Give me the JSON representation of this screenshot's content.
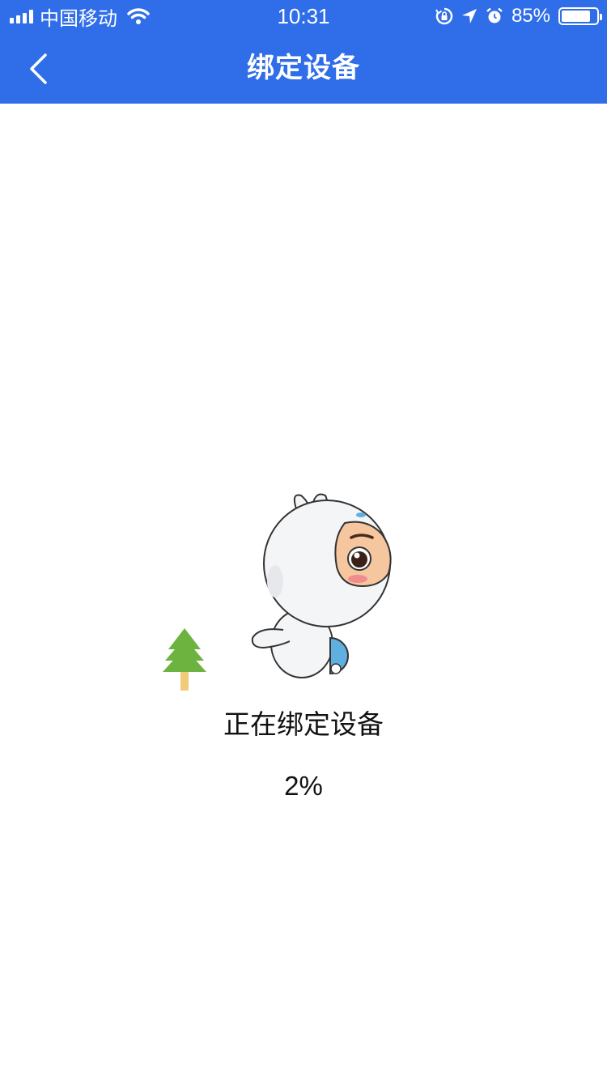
{
  "status_bar": {
    "carrier": "中国移动",
    "time": "10:31",
    "battery_percent_text": "85%",
    "battery_level": 0.85
  },
  "nav": {
    "title": "绑定设备",
    "back_icon": "chevron-left-icon"
  },
  "binding": {
    "status_label": "正在绑定设备",
    "progress_text": "2%",
    "progress": 0.02
  },
  "colors": {
    "nav_background": "#2f6ee8",
    "tree_green": "#6db33f",
    "tree_trunk": "#f0cc7a"
  }
}
